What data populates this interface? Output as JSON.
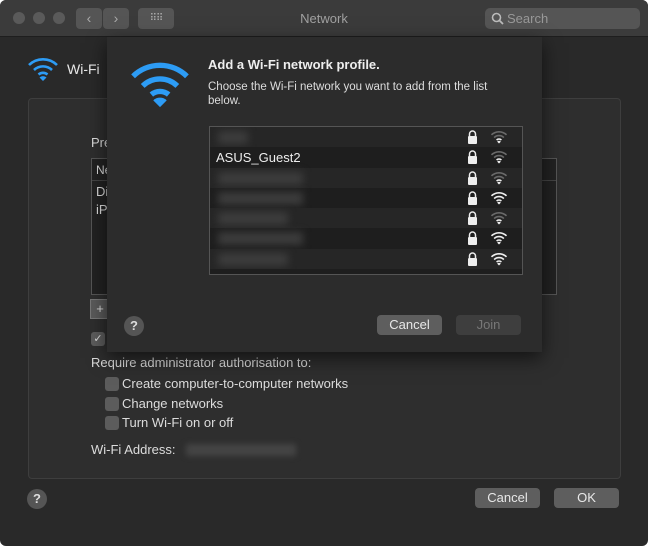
{
  "window": {
    "title": "Network",
    "search_placeholder": "Search"
  },
  "sidebar": {
    "wifi_label": "Wi-Fi"
  },
  "background": {
    "profiles_label_fragment": "Pre",
    "table_header_fragment": "Ne",
    "rows_fragments": [
      "Di",
      "iP"
    ],
    "add_remove": "+",
    "require_label": "Require administrator authorisation to:",
    "options": [
      {
        "label": "Create computer-to-computer networks",
        "checked": false
      },
      {
        "label": "Change networks",
        "checked": false
      },
      {
        "label": "Turn Wi-Fi on or off",
        "checked": false
      }
    ],
    "wifi_address_label": "Wi-Fi Address:",
    "cancel": "Cancel",
    "ok": "OK",
    "help": "?"
  },
  "sheet": {
    "title": "Add a Wi-Fi network profile.",
    "description": "Choose the Wi-Fi network you want to add from the list below.",
    "networks": [
      {
        "name": "",
        "blurred": true,
        "secured": true,
        "signal": "weak"
      },
      {
        "name": "ASUS_Guest2",
        "blurred": false,
        "secured": true,
        "signal": "weak"
      },
      {
        "name": "",
        "blurred": true,
        "secured": true,
        "signal": "weak"
      },
      {
        "name": "",
        "blurred": true,
        "secured": true,
        "signal": "strong"
      },
      {
        "name": "",
        "blurred": true,
        "secured": true,
        "signal": "weak"
      },
      {
        "name": "",
        "blurred": true,
        "secured": true,
        "signal": "strong"
      },
      {
        "name": "",
        "blurred": true,
        "secured": true,
        "signal": "strong"
      }
    ],
    "cancel": "Cancel",
    "join": "Join",
    "help": "?",
    "accent": "#2d9cf5"
  }
}
